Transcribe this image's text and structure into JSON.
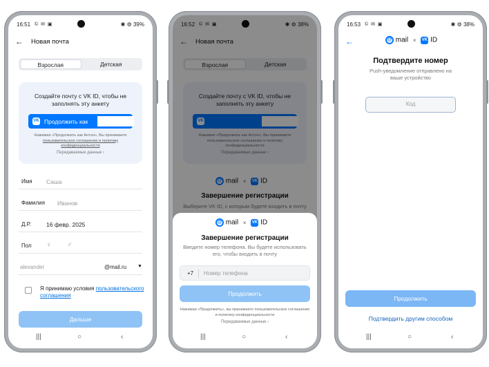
{
  "colors": {
    "accent": "#0077ff",
    "disabled_button": "#8fc3f5",
    "page_bg": "#ffffff"
  },
  "phone1": {
    "status": {
      "time": "16:51",
      "icons": "© ✉ ▣",
      "battery": "✱ ⚙ 39%"
    },
    "appbar": {
      "back_icon": "arrow-left-icon",
      "title": "Новая почта"
    },
    "tabs": [
      "Взрослая",
      "Детская"
    ],
    "vk_card": {
      "text": "Создайте почту с VK ID, чтобы не заполнять эту анкету",
      "button_label": "Продолжить как",
      "legal": "Нажимая «Продолжить как Антон», Вы принимаете",
      "legal_link": "пользовательское соглашение и политику конфиденциальности",
      "link": "Передаваемые данные ›"
    },
    "fields": [
      {
        "label": "Имя",
        "value": "Саша"
      },
      {
        "label": "Фамилия",
        "value": "Иванов"
      },
      {
        "label": "Д.Р.",
        "value": "16 февр. 2025"
      },
      {
        "label": "Пол",
        "value": ""
      }
    ],
    "login": {
      "placeholder": "alexander",
      "domain": "@mail.ru"
    },
    "agree_text": "Я принимаю условия",
    "agree_link": "пользовательского соглашения",
    "submit": "Дальше",
    "nav": [
      "|||",
      "○",
      "‹"
    ]
  },
  "phone2": {
    "status": {
      "time": "16:52",
      "icons": "© ✉ ▣",
      "battery": "✱ ⚙ 38%"
    },
    "appbar": {
      "title": "Новая почта"
    },
    "tabs": [
      "Взрослая",
      "Детская"
    ],
    "bg_card": {
      "text": "Создайте почту с VK ID, чтобы не заполнять эту анкету",
      "legal": "Нажимая «Продолжить как Антон», Вы принимаете пользовательское соглашение и политику конфиденциальности",
      "link": "Передаваемые данные ›"
    },
    "bg_brand": {
      "mail": "mail",
      "x": "×",
      "id": "ID"
    },
    "bg_title": "Завершение регистрации",
    "bg_sub": "Выберите VK ID, с которым будете входить в почту",
    "sheet": {
      "brand": {
        "mail": "mail",
        "x": "×",
        "id": "ID"
      },
      "title": "Завершение регистрации",
      "subtitle": "Введите номер телефона. Вы будете использовать его, чтобы входить в почту",
      "prefix": "+7",
      "placeholder": "Номер телефона",
      "button": "Продолжить",
      "legal": "Нажимая «Продолжить», вы принимаете пользовательское соглашение и политику конфиденциальности",
      "link": "Передаваемые данные ›"
    },
    "nav": [
      "|||",
      "○",
      "‹"
    ]
  },
  "phone3": {
    "status": {
      "time": "16:53",
      "icons": "© ✉ ▣",
      "battery": "✱ ⚙ 38%"
    },
    "brand": {
      "mail": "mail",
      "x": "×",
      "id": "ID"
    },
    "title": "Подтвердите номер",
    "subtitle": "Push-уведомление отправлено на ваше устройство",
    "code_placeholder": "Код",
    "button": "Продолжить",
    "alt_link": "Подтвердить другим способом",
    "nav": [
      "|||",
      "○",
      "‹"
    ]
  }
}
